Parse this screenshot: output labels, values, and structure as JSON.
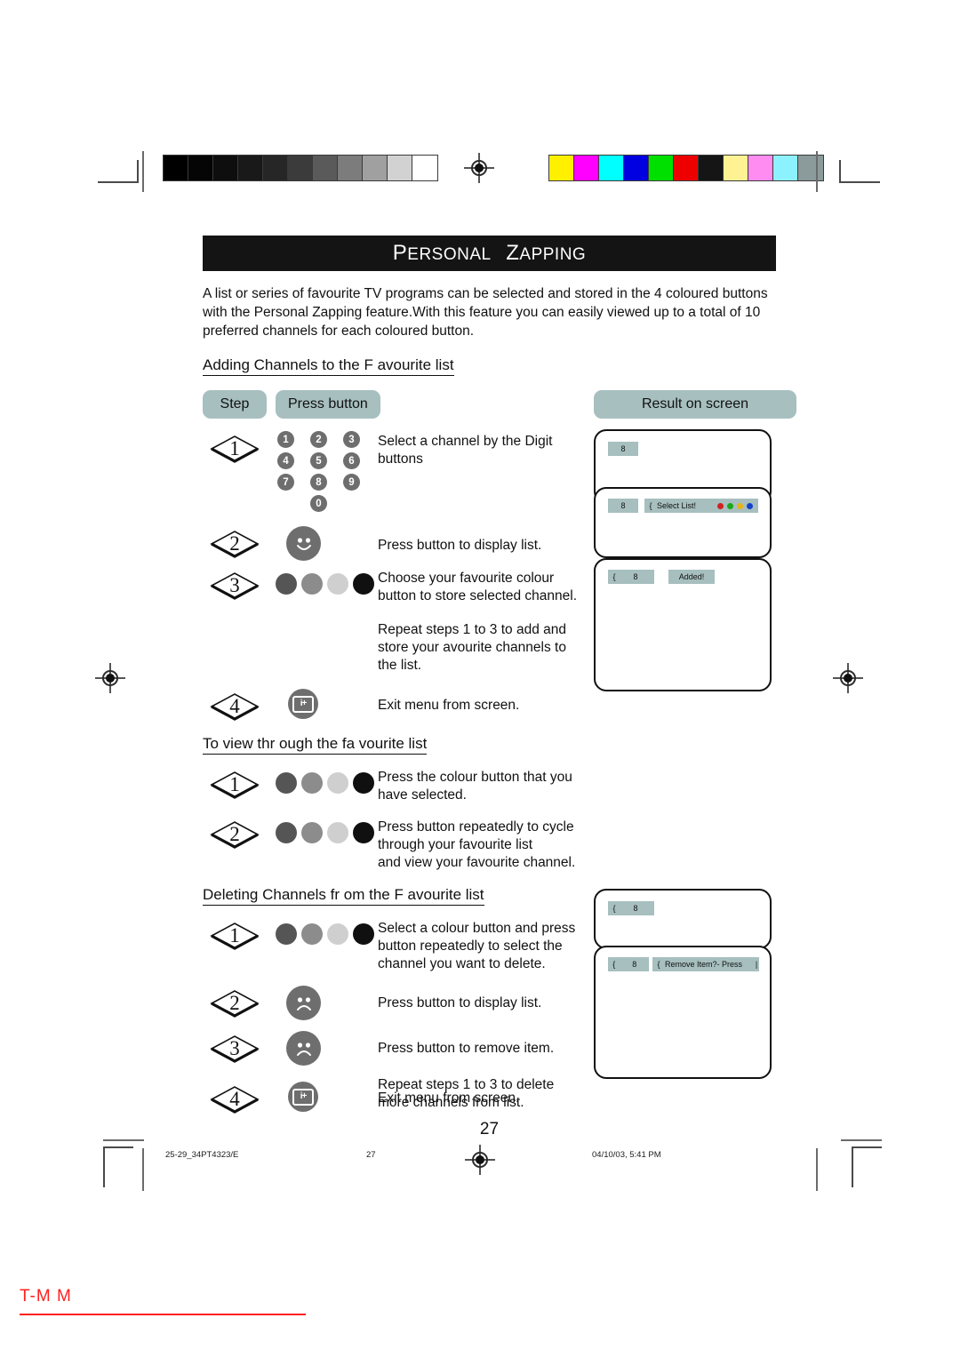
{
  "header": {
    "title_part1": "Personal",
    "title_part2": "Zapping"
  },
  "intro": "A list or series of favourite TV programs can be selected and stored in the 4 coloured buttons with the Personal Zapping feature.With this feature you can easily viewed up to a total of 10 preferred channels for each coloured button.",
  "table_headers": {
    "step": "Step",
    "press_button": "Press button",
    "result": "Result on screen"
  },
  "sections": [
    {
      "heading": "Adding Channels to the F avourite list ",
      "rows": [
        {
          "step": "1",
          "button": "keypad",
          "text": "Select a channel by the Digit\nbuttons"
        },
        {
          "step": "2",
          "button": "smiley-happy",
          "text": "Press button to display list."
        },
        {
          "step": "3",
          "button": "colour-dots",
          "text": "Choose your favourite colour\nbutton to store selected channel."
        },
        {
          "step": "",
          "button": "none",
          "text": "Repeat steps 1 to 3 to add and\nstore your avourite channels to\nthe list."
        },
        {
          "step": "4",
          "button": "info-exit",
          "text": "Exit menu from screen."
        }
      ]
    },
    {
      "heading": "To view thr ough the fa vourite list ",
      "rows": [
        {
          "step": "1",
          "button": "colour-dots",
          "text": "Press the colour button that you\nhave selected."
        },
        {
          "step": "2",
          "button": "colour-dots",
          "text": "Press button repeatedly to cycle\nthrough your favourite list\nand view your favourite channel."
        }
      ]
    },
    {
      "heading": "Deleting Channels fr om the F avourite list ",
      "rows": [
        {
          "step": "1",
          "button": "colour-dots",
          "text": "Select a colour button and press\nbutton repeatedly to select the\nchannel you want to delete."
        },
        {
          "step": "2",
          "button": "smiley-sad",
          "text": "Press button to display list."
        },
        {
          "step": "3",
          "button": "smiley-sad",
          "text": "Press button to remove item."
        },
        {
          "step": "",
          "button": "none",
          "text": "Repeat steps 1 to 3 to delete\nmore channels from list."
        },
        {
          "step": "4",
          "button": "info-exit",
          "text": "Exit menu from screen."
        }
      ]
    }
  ],
  "keypad_digits": [
    "1",
    "2",
    "3",
    "4",
    "5",
    "6",
    "7",
    "8",
    "9",
    "0"
  ],
  "colour_buttons": [
    "#555555",
    "#8c8c8c",
    "#cfcfcf",
    "#101010"
  ],
  "screens_add": [
    {
      "channel": "8",
      "brace": "",
      "label": "",
      "leds": [],
      "end": ""
    },
    {
      "channel": "8",
      "brace": "{",
      "label": "Select List!",
      "leds": [
        "#d32020",
        "#1aa81a",
        "#e8b317",
        "#1642c8"
      ],
      "end": ""
    },
    {
      "channel": "8",
      "brace": "{",
      "label": "Added!",
      "leds": [],
      "end": ""
    }
  ],
  "screens_delete": [
    {
      "channel": "8",
      "brace": "{",
      "label": "",
      "leds": [],
      "end": ""
    },
    {
      "channel": "8",
      "brace": "{",
      "label": "Remove Item?- Press",
      "leds": [],
      "end": "|"
    }
  ],
  "page_number": "27",
  "footer": {
    "file": "25-29_34PT4323/E",
    "page": "27",
    "timestamp": "04/10/03, 5:41 PM"
  },
  "corner_label": "T-M M",
  "gray_bar": [
    "#000000",
    "#050505",
    "#0e0e0e",
    "#191919",
    "#262626",
    "#3b3b3b",
    "#5a5a5a",
    "#7c7c7c",
    "#a0a0a0",
    "#d2d2d2",
    "#ffffff"
  ],
  "colour_bar": [
    "#fff000",
    "#ff00ff",
    "#00ffff",
    "#0000e0",
    "#00e000",
    "#ee0000",
    "#151515",
    "#fff293",
    "#ff8cf0",
    "#8cf2ff",
    "#8b9a9a"
  ],
  "accent": {
    "osd_bg": "#a7bfbf",
    "pill_bg": "#a7bfbf",
    "title_bg": "#141414",
    "red": "#ff2020"
  }
}
